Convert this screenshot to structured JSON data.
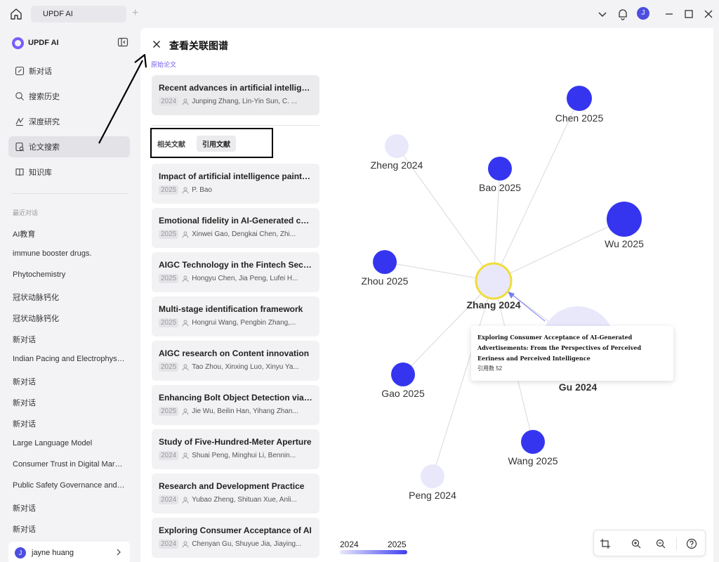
{
  "titlebar": {
    "tab_label": "UPDF AI",
    "avatar_initial": "J"
  },
  "sidebar": {
    "brand": "UPDF AI",
    "nav": [
      {
        "label": "新对话",
        "icon": "edit-icon"
      },
      {
        "label": "搜索历史",
        "icon": "search-icon"
      },
      {
        "label": "深度研究",
        "icon": "research-icon"
      },
      {
        "label": "论文搜索",
        "icon": "paper-icon"
      },
      {
        "label": "知识库",
        "icon": "book-icon"
      }
    ],
    "recent_label": "最近对话",
    "recent": [
      "AI教育",
      "immune booster drugs.",
      "Phytochemistry",
      "冠状动脉钙化",
      "冠状动脉钙化",
      "新对话",
      "Indian Pacing and Electrophysiology Journal",
      "新对话",
      "新对话",
      "新对话",
      "Large Language Model",
      "Consumer Trust in Digital Marketing",
      "Public Safety Governance and AI",
      "新对话",
      "新对话"
    ],
    "user": {
      "initial": "J",
      "name": "jayne huang"
    }
  },
  "panel": {
    "title": "查看关联图谱",
    "original_label": "原始论文",
    "original": {
      "title": "Recent advances in artificial intelligence",
      "year": "2024",
      "authors": "Junping Zhang, Lin-Yin Sun, C. ..."
    },
    "tabs": [
      "相关文献",
      "引用文献"
    ],
    "papers": [
      {
        "title": "Impact of artificial intelligence painting",
        "year": "2025",
        "authors": "P. Bao"
      },
      {
        "title": "Emotional fidelity in AI-Generated content",
        "year": "2025",
        "authors": "Xinwei Gao, Dengkai Chen, Zhi..."
      },
      {
        "title": "AIGC Technology in the Fintech Sector",
        "year": "2025",
        "authors": "Hongyu Chen, Jia Peng, Lufei H..."
      },
      {
        "title": "Multi-stage identification framework",
        "year": "2025",
        "authors": "Hongrui Wang, Pengbin Zhang,..."
      },
      {
        "title": "AIGC research on Content innovation",
        "year": "2025",
        "authors": "Tao Zhou, Xinxing Luo, Xinyu Ya..."
      },
      {
        "title": "Enhancing Bolt Object Detection via AIGC",
        "year": "2025",
        "authors": "Jie Wu, Beilin Han, Yihang Zhan..."
      },
      {
        "title": "Study of Five-Hundred-Meter Aperture",
        "year": "2024",
        "authors": "Shuai Peng, Minghui Li, Bennin..."
      },
      {
        "title": "Research and Development Practice",
        "year": "2024",
        "authors": "Yubao Zheng, Shituan Xue, Anli..."
      },
      {
        "title": "Exploring Consumer Acceptance of AI",
        "year": "2024",
        "authors": "Chenyan Gu, Shuyue Jia, Jiaying..."
      }
    ]
  },
  "graph": {
    "center": {
      "label": "Zhang 2024"
    },
    "nodes": [
      {
        "label": "Chen 2025",
        "year": 2025,
        "citations": 0
      },
      {
        "label": "Zheng 2024",
        "year": 2024,
        "citations": 0
      },
      {
        "label": "Bao 2025",
        "year": 2025,
        "citations": 0
      },
      {
        "label": "Wu 2025",
        "year": 2025,
        "citations": 0
      },
      {
        "label": "Zhou 2025",
        "year": 2025,
        "citations": 0
      },
      {
        "label": "Gu 2024",
        "year": 2024,
        "citations": 52
      },
      {
        "label": "Gao 2025",
        "year": 2025,
        "citations": 0
      },
      {
        "label": "Wang 2025",
        "year": 2025,
        "citations": 0
      },
      {
        "label": "Peng 2024",
        "year": 2024,
        "citations": 0
      }
    ],
    "tooltip": {
      "title": "Exploring Consumer Acceptance of AI-Generated Advertisements: From the Perspectives of Perceived Eeriness and Perceived Intelligence",
      "citations": "引用数 52"
    },
    "legend": {
      "min": "2024",
      "max": "2025"
    },
    "colors": {
      "year_2024": "#e9e8fb",
      "year_2025": "#3535f0",
      "center_ring": "#f0dc3a",
      "link": "#d8d8e0"
    }
  }
}
